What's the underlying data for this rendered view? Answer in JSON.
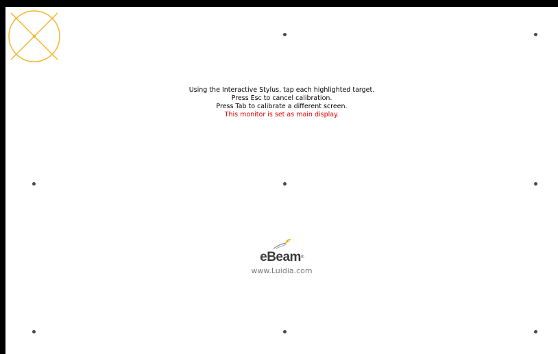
{
  "instructions": {
    "line1": "Using the Interactive Stylus, tap each highlighted target.",
    "line2": "Press Esc to cancel calibration.",
    "line3": "Press Tab to calibrate a different screen.",
    "line4": "This monitor is set as main display.",
    "warning_color": "#e00000"
  },
  "logo": {
    "brand": "eBeam",
    "trademark": "®",
    "url": "www.Luidia.com",
    "mark_icon": "luidia-swoosh-icon",
    "mark_color": "#f5a800"
  },
  "calibration": {
    "active_target_color": "#f5b52a",
    "active_target_icon": "crosshair-target-icon",
    "dot_color": "#4a4a4a",
    "grid": "3x3",
    "active_target_index": 0
  }
}
